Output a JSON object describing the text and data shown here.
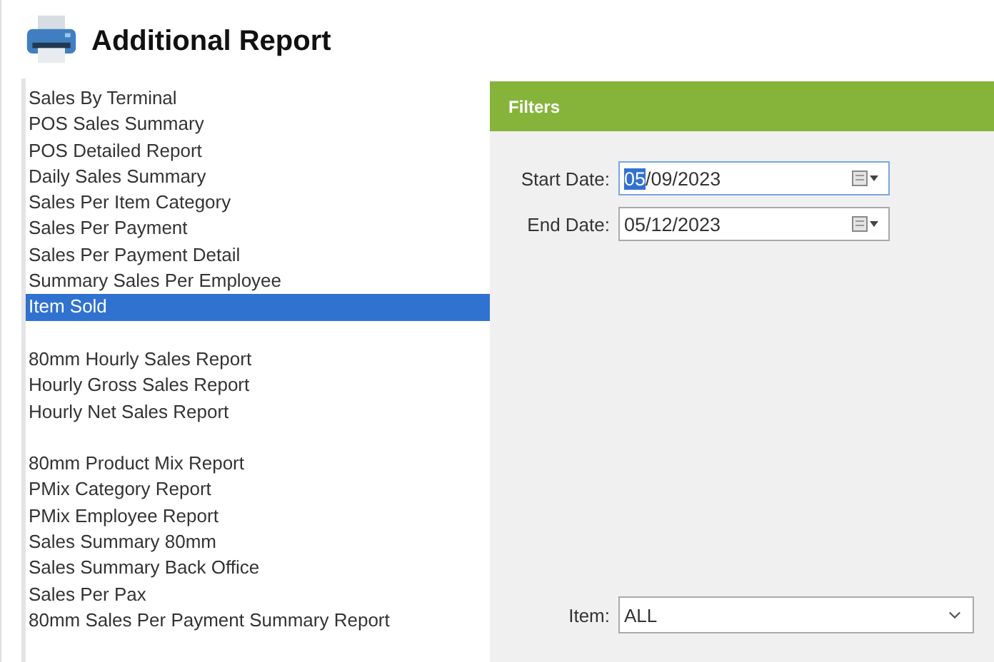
{
  "header": {
    "title": "Additional Report"
  },
  "report_groups": [
    {
      "items": [
        {
          "label": "Sales By Terminal",
          "selected": false
        },
        {
          "label": "POS Sales Summary",
          "selected": false
        },
        {
          "label": "POS Detailed Report",
          "selected": false
        },
        {
          "label": "Daily Sales Summary",
          "selected": false
        },
        {
          "label": "Sales Per Item Category",
          "selected": false
        },
        {
          "label": "Sales Per Payment",
          "selected": false
        },
        {
          "label": "Sales Per Payment Detail",
          "selected": false
        },
        {
          "label": "Summary Sales Per Employee",
          "selected": false
        },
        {
          "label": "Item Sold",
          "selected": true
        }
      ]
    },
    {
      "items": [
        {
          "label": "80mm Hourly Sales Report",
          "selected": false
        },
        {
          "label": "Hourly Gross Sales Report",
          "selected": false
        },
        {
          "label": "Hourly Net Sales Report",
          "selected": false
        }
      ]
    },
    {
      "items": [
        {
          "label": "80mm Product Mix Report",
          "selected": false
        },
        {
          "label": "PMix Category Report",
          "selected": false
        },
        {
          "label": "PMix Employee Report",
          "selected": false
        },
        {
          "label": "Sales Summary 80mm",
          "selected": false
        },
        {
          "label": "Sales Summary Back Office",
          "selected": false
        },
        {
          "label": "Sales Per Pax",
          "selected": false
        },
        {
          "label": "80mm Sales Per Payment Summary Report",
          "selected": false
        }
      ]
    }
  ],
  "filters": {
    "title": "Filters",
    "dates": [
      {
        "label": "Start Date:",
        "value": "05/09/2023",
        "focused": true
      },
      {
        "label": "End Date:",
        "value": "05/12/2023",
        "focused": false
      }
    ],
    "item": {
      "label": "Item:",
      "value": "ALL"
    }
  }
}
